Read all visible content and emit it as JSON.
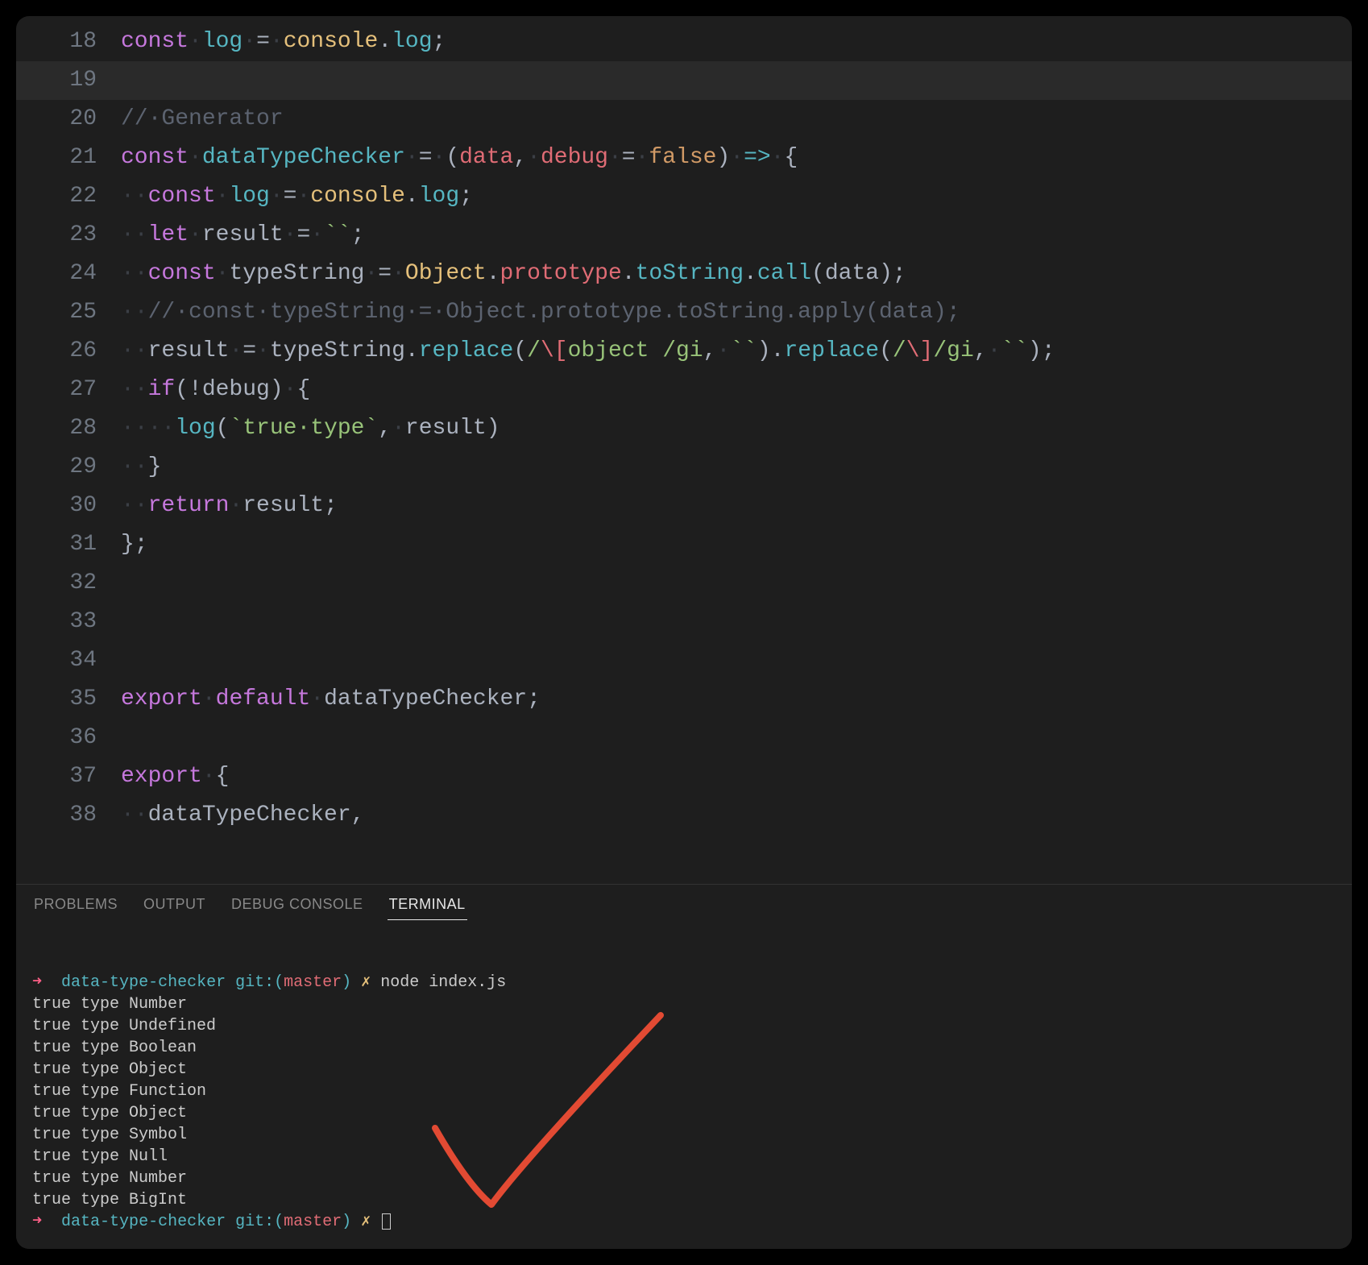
{
  "editor": {
    "lines": [
      {
        "num": 18,
        "tokens": [
          [
            "kw",
            "const"
          ],
          [
            "ws",
            "·"
          ],
          [
            "fn",
            "log"
          ],
          [
            "ws",
            "·"
          ],
          [
            "id",
            "="
          ],
          [
            "ws",
            "·"
          ],
          [
            "var",
            "console"
          ],
          [
            "id",
            "."
          ],
          [
            "fn",
            "log"
          ],
          [
            "id",
            ";"
          ]
        ]
      },
      {
        "num": 19,
        "tokens": [],
        "current": true
      },
      {
        "num": 20,
        "tokens": [
          [
            "cmt",
            "//·Generator"
          ]
        ]
      },
      {
        "num": 21,
        "tokens": [
          [
            "kw",
            "const"
          ],
          [
            "ws",
            "·"
          ],
          [
            "fn",
            "dataTypeChecker"
          ],
          [
            "ws",
            "·"
          ],
          [
            "id",
            "="
          ],
          [
            "ws",
            "·"
          ],
          [
            "id",
            "("
          ],
          [
            "param",
            "data"
          ],
          [
            "id",
            ","
          ],
          [
            "ws",
            "·"
          ],
          [
            "param",
            "debug"
          ],
          [
            "ws",
            "·"
          ],
          [
            "id",
            "="
          ],
          [
            "ws",
            "·"
          ],
          [
            "num",
            "false"
          ],
          [
            "id",
            ")"
          ],
          [
            "ws",
            "·"
          ],
          [
            "op",
            "=>"
          ],
          [
            "ws",
            "·"
          ],
          [
            "id",
            "{"
          ]
        ]
      },
      {
        "num": 22,
        "tokens": [
          [
            "ws",
            "··"
          ],
          [
            "kw",
            "const"
          ],
          [
            "ws",
            "·"
          ],
          [
            "fn",
            "log"
          ],
          [
            "ws",
            "·"
          ],
          [
            "id",
            "="
          ],
          [
            "ws",
            "·"
          ],
          [
            "var",
            "console"
          ],
          [
            "id",
            "."
          ],
          [
            "fn",
            "log"
          ],
          [
            "id",
            ";"
          ]
        ]
      },
      {
        "num": 23,
        "tokens": [
          [
            "ws",
            "··"
          ],
          [
            "kw",
            "let"
          ],
          [
            "ws",
            "·"
          ],
          [
            "id",
            "result"
          ],
          [
            "ws",
            "·"
          ],
          [
            "id",
            "="
          ],
          [
            "ws",
            "·"
          ],
          [
            "str",
            "``"
          ],
          [
            "id",
            ";"
          ]
        ]
      },
      {
        "num": 24,
        "tokens": [
          [
            "ws",
            "··"
          ],
          [
            "kw",
            "const"
          ],
          [
            "ws",
            "·"
          ],
          [
            "id",
            "typeString"
          ],
          [
            "ws",
            "·"
          ],
          [
            "id",
            "="
          ],
          [
            "ws",
            "·"
          ],
          [
            "var",
            "Object"
          ],
          [
            "id",
            "."
          ],
          [
            "prop",
            "prototype"
          ],
          [
            "id",
            "."
          ],
          [
            "fn",
            "toString"
          ],
          [
            "id",
            "."
          ],
          [
            "fn",
            "call"
          ],
          [
            "id",
            "("
          ],
          [
            "id",
            "data"
          ],
          [
            "id",
            ")"
          ],
          [
            "id",
            ";"
          ]
        ]
      },
      {
        "num": 25,
        "tokens": [
          [
            "ws",
            "··"
          ],
          [
            "cmt",
            "//·const·typeString·=·Object.prototype.toString.apply(data);"
          ]
        ]
      },
      {
        "num": 26,
        "tokens": [
          [
            "ws",
            "··"
          ],
          [
            "id",
            "result"
          ],
          [
            "ws",
            "·"
          ],
          [
            "id",
            "="
          ],
          [
            "ws",
            "·"
          ],
          [
            "id",
            "typeString"
          ],
          [
            "id",
            "."
          ],
          [
            "fn",
            "replace"
          ],
          [
            "id",
            "("
          ],
          [
            "rexd",
            "/"
          ],
          [
            "rex",
            "\\["
          ],
          [
            "str",
            "object "
          ],
          [
            "rexd",
            "/gi"
          ],
          [
            "id",
            ","
          ],
          [
            "ws",
            "·"
          ],
          [
            "str",
            "``"
          ],
          [
            "id",
            ")"
          ],
          [
            "id",
            "."
          ],
          [
            "fn",
            "replace"
          ],
          [
            "id",
            "("
          ],
          [
            "rexd",
            "/"
          ],
          [
            "rex",
            "\\]"
          ],
          [
            "rexd",
            "/gi"
          ],
          [
            "id",
            ","
          ],
          [
            "ws",
            "·"
          ],
          [
            "str",
            "``"
          ],
          [
            "id",
            ")"
          ],
          [
            "id",
            ";"
          ]
        ]
      },
      {
        "num": 27,
        "tokens": [
          [
            "ws",
            "··"
          ],
          [
            "kw",
            "if"
          ],
          [
            "id",
            "(!"
          ],
          [
            "id",
            "debug"
          ],
          [
            "id",
            ")"
          ],
          [
            "ws",
            "·"
          ],
          [
            "id",
            "{"
          ]
        ]
      },
      {
        "num": 28,
        "tokens": [
          [
            "ws",
            "····"
          ],
          [
            "fn",
            "log"
          ],
          [
            "id",
            "("
          ],
          [
            "str",
            "`true·type`"
          ],
          [
            "id",
            ","
          ],
          [
            "ws",
            "·"
          ],
          [
            "id",
            "result"
          ],
          [
            "id",
            ")"
          ]
        ]
      },
      {
        "num": 29,
        "tokens": [
          [
            "ws",
            "··"
          ],
          [
            "id",
            "}"
          ]
        ]
      },
      {
        "num": 30,
        "tokens": [
          [
            "ws",
            "··"
          ],
          [
            "kw",
            "return"
          ],
          [
            "ws",
            "·"
          ],
          [
            "id",
            "result"
          ],
          [
            "id",
            ";"
          ]
        ]
      },
      {
        "num": 31,
        "tokens": [
          [
            "id",
            "};"
          ]
        ]
      },
      {
        "num": 32,
        "tokens": []
      },
      {
        "num": 33,
        "tokens": []
      },
      {
        "num": 34,
        "tokens": []
      },
      {
        "num": 35,
        "tokens": [
          [
            "kw",
            "export"
          ],
          [
            "ws",
            "·"
          ],
          [
            "kw",
            "default"
          ],
          [
            "ws",
            "·"
          ],
          [
            "id",
            "dataTypeChecker"
          ],
          [
            "id",
            ";"
          ]
        ]
      },
      {
        "num": 36,
        "tokens": []
      },
      {
        "num": 37,
        "tokens": [
          [
            "kw",
            "export"
          ],
          [
            "ws",
            "·"
          ],
          [
            "id",
            "{"
          ]
        ]
      },
      {
        "num": 38,
        "tokens": [
          [
            "ws",
            "··"
          ],
          [
            "id",
            "dataTypeChecker"
          ],
          [
            "id",
            ","
          ]
        ]
      }
    ]
  },
  "panel": {
    "tabs": [
      {
        "label": "PROBLEMS",
        "active": false
      },
      {
        "label": "OUTPUT",
        "active": false
      },
      {
        "label": "DEBUG CONSOLE",
        "active": false
      },
      {
        "label": "TERMINAL",
        "active": true
      }
    ]
  },
  "terminal": {
    "prompt1": {
      "arrow": "➜",
      "folder": "data-type-checker",
      "git": "git:",
      "branch": "master",
      "x": "✗",
      "cmd": "node index.js"
    },
    "output": [
      "true type Number",
      "true type Undefined",
      "true type Boolean",
      "true type Object",
      "true type Function",
      "true type Object",
      "true type Symbol",
      "true type Null",
      "true type Number",
      "true type BigInt"
    ],
    "prompt2": {
      "arrow": "➜",
      "folder": "data-type-checker",
      "git": "git:",
      "branch": "master",
      "x": "✗"
    }
  }
}
